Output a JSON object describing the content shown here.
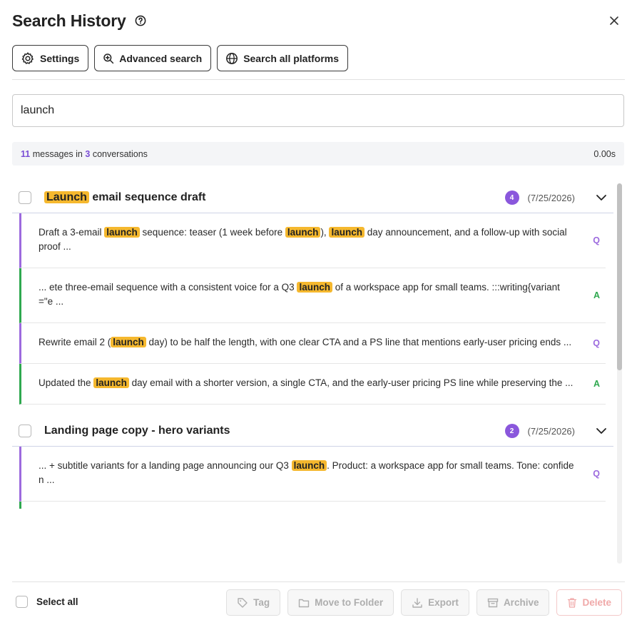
{
  "header": {
    "title": "Search History"
  },
  "toolbar": {
    "settings_label": "Settings",
    "advanced_label": "Advanced search",
    "platforms_label": "Search all platforms"
  },
  "search": {
    "value": "launch",
    "placeholder": ""
  },
  "stats": {
    "message_count": "11",
    "messages_word": "messages in",
    "conversation_count": "3",
    "conversations_word": "conversations",
    "time": "0.00s"
  },
  "groups": [
    {
      "title_highlight": "Launch",
      "title_rest": " email sequence draft",
      "count": "4",
      "date": "(7/25/2026)",
      "messages": [
        {
          "role": "Q",
          "parts": [
            "Draft a 3-email ",
            "launch",
            " sequence: teaser (1 week before ",
            "launch",
            "), ",
            "launch",
            " day announcement, and a follow-up with social proof ..."
          ]
        },
        {
          "role": "A",
          "parts": [
            "... ete three-email sequence with a consistent voice for a Q3 ",
            "launch",
            " of a workspace app for small teams. :::writing{variant=\"e ..."
          ]
        },
        {
          "role": "Q",
          "parts": [
            "Rewrite email 2 (",
            "launch",
            " day) to be half the length, with one clear CTA and a PS line that mentions early-user pricing ends ..."
          ]
        },
        {
          "role": "A",
          "parts": [
            "Updated the ",
            "launch",
            " day email with a shorter version, a single CTA, and the early-user pricing PS line while preserving the ..."
          ]
        }
      ]
    },
    {
      "title": "Landing page copy - hero variants",
      "count": "2",
      "date": "(7/25/2026)",
      "messages": [
        {
          "role": "Q",
          "parts": [
            "... + subtitle variants for a landing page announcing our Q3 ",
            "launch",
            ". Product: a workspace app for small teams. Tone: confiden ..."
          ]
        }
      ]
    }
  ],
  "footer": {
    "select_all": "Select all",
    "tag": "Tag",
    "move": "Move to Folder",
    "export": "Export",
    "archive": "Archive",
    "delete": "Delete"
  },
  "colors": {
    "accent": "#8a57dc",
    "question": "#9c6ade",
    "answer": "#2fa84f",
    "highlight": "#f5b82e",
    "danger": "#f0a9a9"
  },
  "icons": [
    "help-circle-icon",
    "close-icon",
    "gear-icon",
    "zoom-in-icon",
    "globe-icon",
    "chevron-down-icon",
    "tag-icon",
    "folder-icon",
    "download-icon",
    "archive-icon",
    "trash-icon"
  ]
}
